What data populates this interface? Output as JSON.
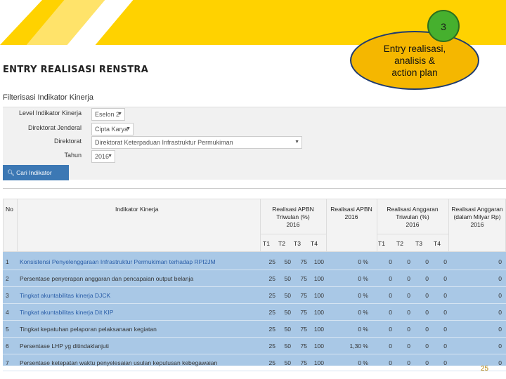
{
  "callout": {
    "number": "3",
    "lines": [
      "Entry realisasi,",
      "analisis &",
      "action plan"
    ]
  },
  "page_title": "ENTRY REALISASI RENSTRA",
  "filter": {
    "title": "Filterisasi Indikator Kinerja",
    "fields": [
      {
        "label": "Level Indikator Kinerja",
        "value": "Eselon 2"
      },
      {
        "label": "Direktorat Jenderal",
        "value": "Cipta Karya"
      },
      {
        "label": "Direktorat",
        "value": "Direktorat Keterpaduan Infrastruktur Permukiman"
      },
      {
        "label": "Tahun",
        "value": "2016"
      }
    ],
    "search_button": "Cari Indikator Kinerja"
  },
  "table": {
    "headers": {
      "no": "No",
      "indikator": "Indikator Kinerja",
      "realisasi_apbn_triwulan": [
        "Realisasi APBN",
        "Triwulan (%)",
        "2016"
      ],
      "realisasi_apbn": [
        "Realisasi APBN",
        "2016"
      ],
      "realisasi_anggaran_triwulan": [
        "Realisasi Anggaran",
        "Triwulan (%)",
        "2016"
      ],
      "realisasi_anggaran": [
        "Realisasi Anggaran",
        "(dalam Milyar Rp)",
        "2016"
      ],
      "quarters": [
        "T1",
        "T2",
        "T3",
        "T4"
      ]
    },
    "rows": [
      {
        "no": "1",
        "indikator": "Konsistensi Penyelenggaraan Infrastruktur Permukiman terhadap RPI2JM",
        "t": [
          "25",
          "50",
          "75",
          "100"
        ],
        "apbn": "0 %",
        "a": [
          "0",
          "0",
          "0",
          "0"
        ],
        "rp": "0"
      },
      {
        "no": "2",
        "indikator": "Persentase penyerapan anggaran dan pencapaian output belanja",
        "t": [
          "25",
          "50",
          "75",
          "100"
        ],
        "apbn": "0 %",
        "a": [
          "0",
          "0",
          "0",
          "0"
        ],
        "rp": "0"
      },
      {
        "no": "3",
        "indikator": "Tingkat akuntabilitas kinerja DJCK",
        "t": [
          "25",
          "50",
          "75",
          "100"
        ],
        "apbn": "0 %",
        "a": [
          "0",
          "0",
          "0",
          "0"
        ],
        "rp": "0"
      },
      {
        "no": "4",
        "indikator": "Tingkat akuntabilitas kinerja Dit KIP",
        "t": [
          "25",
          "50",
          "75",
          "100"
        ],
        "apbn": "0 %",
        "a": [
          "0",
          "0",
          "0",
          "0"
        ],
        "rp": "0"
      },
      {
        "no": "5",
        "indikator": "Tingkat kepatuhan pelaporan pelaksanaan kegiatan",
        "t": [
          "25",
          "50",
          "75",
          "100"
        ],
        "apbn": "0 %",
        "a": [
          "0",
          "0",
          "0",
          "0"
        ],
        "rp": "0"
      },
      {
        "no": "6",
        "indikator": "Persentase LHP yg ditindaklanjuti",
        "t": [
          "25",
          "50",
          "75",
          "100"
        ],
        "apbn": "1,30 %",
        "a": [
          "0",
          "0",
          "0",
          "0"
        ],
        "rp": "0"
      },
      {
        "no": "7",
        "indikator": "Persentase ketepatan waktu penyelesaian usulan keputusan kebegawaian",
        "t": [
          "25",
          "50",
          "75",
          "100"
        ],
        "apbn": "0 %",
        "a": [
          "0",
          "0",
          "0",
          "0"
        ],
        "rp": "0"
      }
    ]
  },
  "page_number": "25",
  "colors": {
    "banner": "#ffd200",
    "callout_fill": "#f5b700",
    "badge_fill": "#46b02e",
    "button": "#3c78b4",
    "row_bg": "#a9c8e6"
  }
}
